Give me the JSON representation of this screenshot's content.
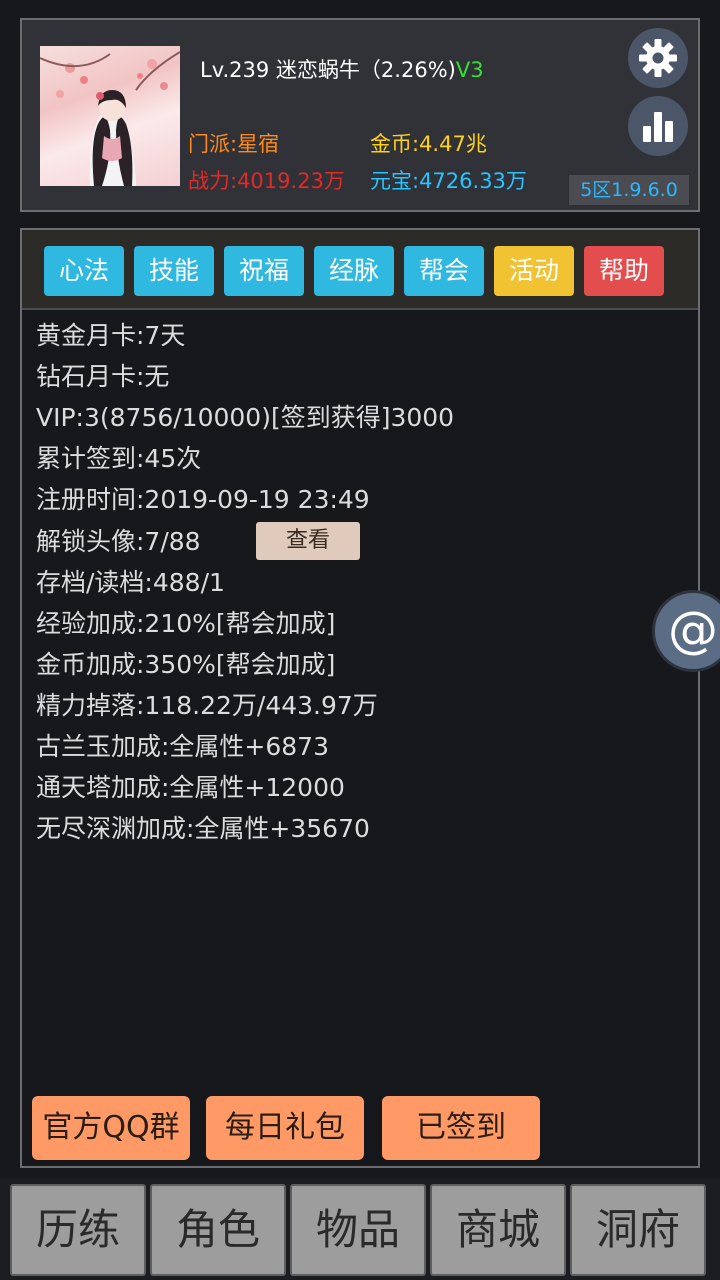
{
  "profile": {
    "level_name": "Lv.239 迷恋蜗牛（2.26%)",
    "vip": "V3",
    "sect": "门派:星宿",
    "gold": "金币:4.47兆",
    "power": "战力:4019.23万",
    "yuanbao": "元宝:4726.33万",
    "version": "5区1.9.6.0",
    "colors": {
      "sect": "#ff8a1f",
      "gold": "#ffd21a",
      "power": "#e12a2a",
      "yuanbao": "#2bc3ff",
      "vip": "#35e034"
    }
  },
  "tabs": [
    {
      "label": "心法",
      "color": "#2fb8e0"
    },
    {
      "label": "技能",
      "color": "#2fb8e0"
    },
    {
      "label": "祝福",
      "color": "#2fb8e0"
    },
    {
      "label": "经脉",
      "color": "#2fb8e0"
    },
    {
      "label": "帮会",
      "color": "#2fb8e0"
    },
    {
      "label": "活动",
      "color": "#f1c232"
    },
    {
      "label": "帮助",
      "color": "#e44d4d"
    }
  ],
  "info": [
    "黄金月卡:7天",
    "钻石月卡:无",
    "VIP:3(8756/10000)[签到获得]3000",
    "累计签到:45次",
    "注册时间:2019-09-19 23:49",
    "解锁头像:7/88",
    "存档/读档:488/1",
    "经验加成:210%[帮会加成]",
    "金币加成:350%[帮会加成]",
    "精力掉落:118.22万/443.97万",
    "古兰玉加成:全属性+6873",
    "通天塔加成:全属性+12000",
    "无尽深渊加成:全属性+35670"
  ],
  "view_button": "查看",
  "actions": {
    "qq_group": "官方QQ群",
    "daily_gift": "每日礼包",
    "signed": "已签到"
  },
  "float_button": "@",
  "nav": [
    "历练",
    "角色",
    "物品",
    "商城",
    "洞府"
  ],
  "icons": {
    "settings": "gear-icon",
    "ranking": "bar-chart-icon"
  }
}
